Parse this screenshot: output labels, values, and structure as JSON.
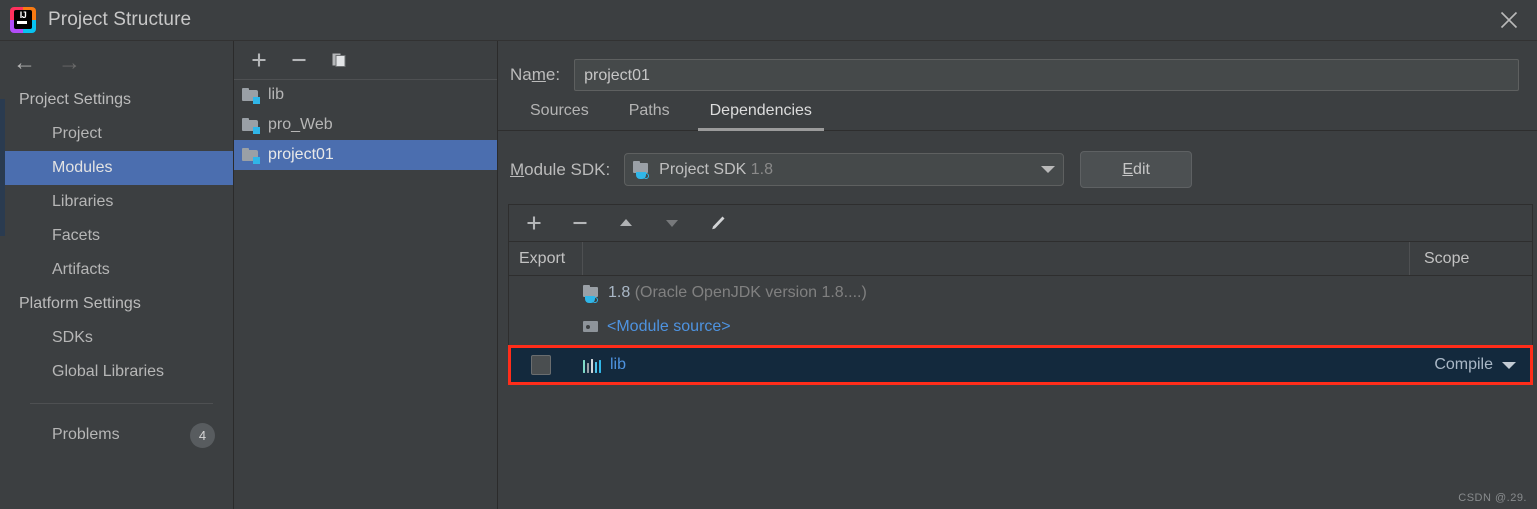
{
  "window": {
    "title": "Project Structure",
    "logo_icon": "intellij-idea-logo",
    "close_icon": "close-icon"
  },
  "sidebar": {
    "back_icon": "arrow-left-icon",
    "forward_icon": "arrow-right-icon",
    "groups": [
      {
        "title": "Project Settings",
        "items": [
          {
            "label": "Project",
            "selected": false
          },
          {
            "label": "Modules",
            "selected": true
          },
          {
            "label": "Libraries",
            "selected": false
          },
          {
            "label": "Facets",
            "selected": false
          },
          {
            "label": "Artifacts",
            "selected": false
          }
        ]
      },
      {
        "title": "Platform Settings",
        "items": [
          {
            "label": "SDKs",
            "selected": false
          },
          {
            "label": "Global Libraries",
            "selected": false
          }
        ]
      }
    ],
    "problems": {
      "label": "Problems",
      "count": "4"
    }
  },
  "modules_panel": {
    "toolbar": {
      "add_icon": "plus-icon",
      "remove_icon": "minus-icon",
      "copy_icon": "copy-icon"
    },
    "items": [
      {
        "label": "lib",
        "selected": false,
        "icon": "module-folder-icon"
      },
      {
        "label": "pro_Web",
        "selected": false,
        "icon": "module-folder-icon"
      },
      {
        "label": "project01",
        "selected": true,
        "icon": "module-folder-icon"
      }
    ]
  },
  "module_editor": {
    "name_label": "Name:",
    "name_value": "project01",
    "tabs": [
      {
        "label": "Sources",
        "active": false
      },
      {
        "label": "Paths",
        "active": false
      },
      {
        "label": "Dependencies",
        "active": true
      }
    ],
    "sdk_label": "Module SDK:",
    "sdk_value": "Project SDK",
    "sdk_version": "1.8",
    "sdk_icon": "jdk-folder-icon",
    "sdk_caret_icon": "chevron-down-icon",
    "edit_button": "Edit",
    "dependencies_toolbar": {
      "add_icon": "plus-icon",
      "remove_icon": "minus-icon",
      "move_up_icon": "arrow-up-icon",
      "move_down_icon": "arrow-down-icon",
      "edit_icon": "pencil-icon"
    },
    "table": {
      "columns": [
        "Export",
        "",
        "Scope"
      ],
      "rows": [
        {
          "name": "1.8",
          "detail": "(Oracle OpenJDK version 1.8....)",
          "icon": "jdk-folder-icon",
          "scope": "",
          "checkbox": false,
          "highlighted": false
        },
        {
          "name": "<Module source>",
          "detail": "",
          "icon": "module-source-icon",
          "scope": "",
          "checkbox": false,
          "highlighted": false
        },
        {
          "name": "lib",
          "detail": "",
          "icon": "library-books-icon",
          "scope": "Compile",
          "checkbox": true,
          "highlighted": true
        }
      ]
    }
  },
  "watermark": "CSDN @.29.",
  "colors": {
    "background": "#3c3f41",
    "selection_blue": "#4b6eaf",
    "highlight_outline": "#ff2d1a",
    "highlight_row_bg": "#13293d",
    "link_blue": "#4e93e0",
    "text": "#b6b6b6"
  }
}
